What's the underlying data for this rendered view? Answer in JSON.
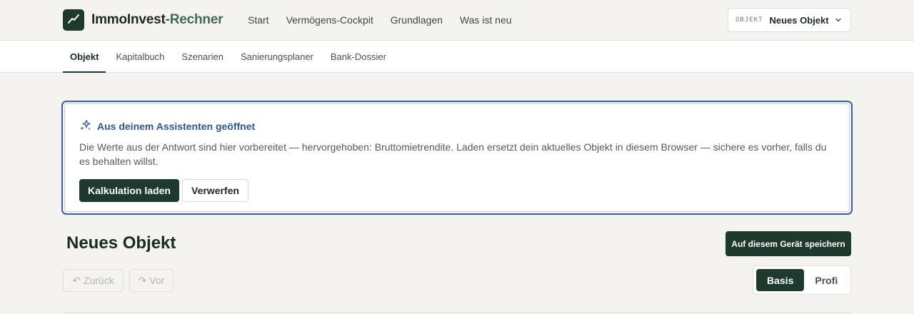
{
  "header": {
    "brand_main": "ImmoInvest",
    "brand_accent": "-Rechner",
    "nav": [
      {
        "label": "Start"
      },
      {
        "label": "Vermögens-Cockpit"
      },
      {
        "label": "Grundlagen"
      },
      {
        "label": "Was ist neu"
      }
    ],
    "object_select": {
      "tag": "OBJEKT",
      "value": "Neues Objekt"
    }
  },
  "tabs": [
    {
      "label": "Objekt",
      "active": true
    },
    {
      "label": "Kapitalbuch",
      "active": false
    },
    {
      "label": "Szenarien",
      "active": false
    },
    {
      "label": "Sanierungsplaner",
      "active": false
    },
    {
      "label": "Bank-Dossier",
      "active": false
    }
  ],
  "notice": {
    "title": "Aus deinem Assistenten geöffnet",
    "text": "Die Werte aus der Antwort sind hier vorbereitet — hervorgehoben: Bruttomietrendite. Laden ersetzt dein aktuelles Objekt in diesem Browser — sichere es vorher, falls du es behalten willst.",
    "primary_label": "Kalkulation laden",
    "secondary_label": "Verwerfen"
  },
  "page": {
    "title": "Neues Objekt",
    "save_label": "Auf diesem Gerät speichern",
    "undo_label": "↶ Zurück",
    "redo_label": "↷ Vor",
    "modes": [
      {
        "label": "Basis",
        "active": true
      },
      {
        "label": "Profi",
        "active": false
      }
    ]
  },
  "colors": {
    "brand": "#1e3a2f",
    "brand_accent": "#3e6b57",
    "notice_accent": "#2f5597",
    "background": "#f4f3ef"
  }
}
